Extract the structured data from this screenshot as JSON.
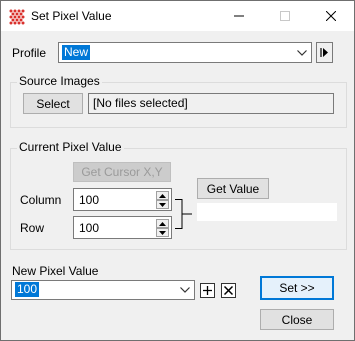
{
  "window": {
    "title": "Set Pixel Value",
    "icons": {
      "app": "grid-dots-icon",
      "minimize": "minimize-icon",
      "maximize": "maximize-icon",
      "close": "close-icon"
    }
  },
  "profile": {
    "label": "Profile",
    "value": "New",
    "next_icon": "play-next-icon"
  },
  "source_images": {
    "group_title": "Source Images",
    "select_label": "Select",
    "files_text": "[No files selected]"
  },
  "current_pixel": {
    "group_title": "Current Pixel Value",
    "get_cursor_label": "Get Cursor X,Y",
    "column_label": "Column",
    "column_value": "100",
    "row_label": "Row",
    "row_value": "100",
    "get_value_label": "Get Value",
    "value_text": ""
  },
  "new_pixel": {
    "label": "New Pixel Value",
    "value": "100",
    "add_icon": "plus-icon",
    "clear_icon": "x-icon"
  },
  "buttons": {
    "set_label": "Set >>",
    "close_label": "Close"
  },
  "colors": {
    "accent": "#0078d7",
    "icon_red": "#d9302c"
  }
}
